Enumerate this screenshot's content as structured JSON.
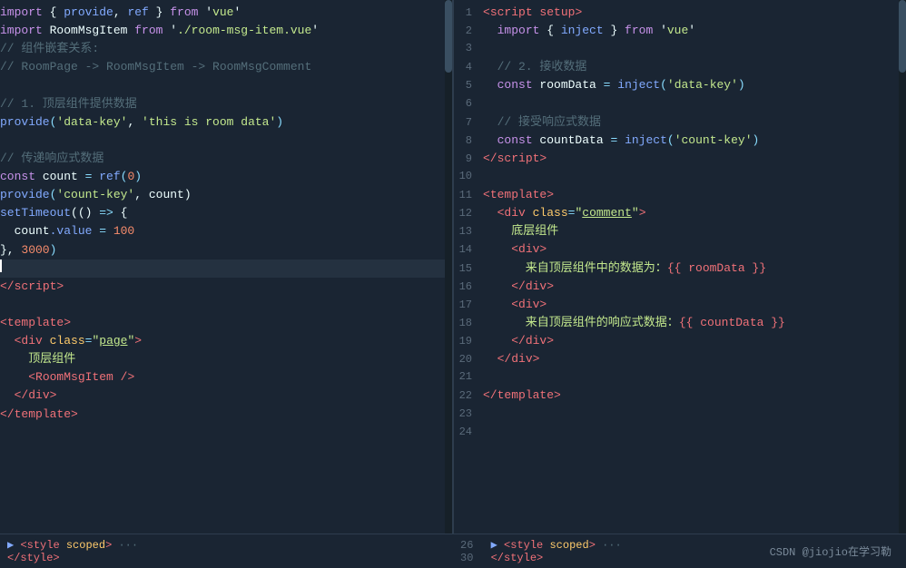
{
  "left_pane": {
    "lines": [
      {
        "num": null,
        "tokens": [
          {
            "text": "import",
            "cls": "kw"
          },
          {
            "text": " { ",
            "cls": "var"
          },
          {
            "text": "provide",
            "cls": "fn"
          },
          {
            "text": ", ",
            "cls": "var"
          },
          {
            "text": "ref",
            "cls": "fn"
          },
          {
            "text": " } ",
            "cls": "var"
          },
          {
            "text": "from",
            "cls": "kw"
          },
          {
            "text": " '",
            "cls": "var"
          },
          {
            "text": "vue",
            "cls": "str"
          },
          {
            "text": "'",
            "cls": "var"
          }
        ]
      },
      {
        "num": null,
        "tokens": [
          {
            "text": "import",
            "cls": "kw"
          },
          {
            "text": " RoomMsgItem ",
            "cls": "var"
          },
          {
            "text": "from",
            "cls": "kw"
          },
          {
            "text": " '",
            "cls": "var"
          },
          {
            "text": "./room-msg-item.vue",
            "cls": "str"
          },
          {
            "text": "'",
            "cls": "var"
          }
        ]
      },
      {
        "num": null,
        "tokens": [
          {
            "text": "// 组件嵌套关系:",
            "cls": "cmt"
          }
        ]
      },
      {
        "num": null,
        "tokens": [
          {
            "text": "// RoomPage -> RoomMsgItem -> RoomMsgComment",
            "cls": "cmt"
          }
        ]
      },
      {
        "num": null,
        "tokens": []
      },
      {
        "num": null,
        "tokens": [
          {
            "text": "// 1. 顶层组件提供数据",
            "cls": "cmt"
          }
        ]
      },
      {
        "num": null,
        "tokens": [
          {
            "text": "provide",
            "cls": "fn"
          },
          {
            "text": "(",
            "cls": "punc"
          },
          {
            "text": "'data-key'",
            "cls": "str"
          },
          {
            "text": ", ",
            "cls": "var"
          },
          {
            "text": "'this is room data'",
            "cls": "str"
          },
          {
            "text": ")",
            "cls": "punc"
          }
        ]
      },
      {
        "num": null,
        "tokens": []
      },
      {
        "num": null,
        "tokens": [
          {
            "text": "// 传递响应式数据",
            "cls": "cmt"
          }
        ]
      },
      {
        "num": null,
        "tokens": [
          {
            "text": "const",
            "cls": "kw"
          },
          {
            "text": " count ",
            "cls": "var"
          },
          {
            "text": "=",
            "cls": "op"
          },
          {
            "text": " ",
            "cls": "var"
          },
          {
            "text": "ref",
            "cls": "fn"
          },
          {
            "text": "(",
            "cls": "punc"
          },
          {
            "text": "0",
            "cls": "num"
          },
          {
            "text": ")",
            "cls": "punc"
          }
        ]
      },
      {
        "num": null,
        "tokens": [
          {
            "text": "provide",
            "cls": "fn"
          },
          {
            "text": "(",
            "cls": "punc"
          },
          {
            "text": "'count-key'",
            "cls": "str"
          },
          {
            "text": ", count)",
            "cls": "var"
          }
        ]
      },
      {
        "num": null,
        "tokens": [
          {
            "text": "setTimeout",
            "cls": "fn"
          },
          {
            "text": "(() ",
            "cls": "var"
          },
          {
            "text": "=>",
            "cls": "op"
          },
          {
            "text": " {",
            "cls": "var"
          }
        ]
      },
      {
        "num": null,
        "tokens": [
          {
            "text": "  count",
            "cls": "var"
          },
          {
            "text": ".value",
            "cls": "prop"
          },
          {
            "text": " = ",
            "cls": "op"
          },
          {
            "text": "100",
            "cls": "num"
          }
        ]
      },
      {
        "num": null,
        "tokens": [
          {
            "text": "}, ",
            "cls": "var"
          },
          {
            "text": "3000",
            "cls": "num"
          },
          {
            "text": ")",
            "cls": "punc"
          }
        ]
      },
      {
        "num": null,
        "tokens": [],
        "cursor": true
      },
      {
        "num": null,
        "tokens": [
          {
            "text": "</",
            "cls": "tag"
          },
          {
            "text": "script",
            "cls": "tag"
          },
          {
            "text": ">",
            "cls": "tag"
          }
        ]
      },
      {
        "num": null,
        "tokens": []
      },
      {
        "num": null,
        "tokens": [
          {
            "text": "<",
            "cls": "tag"
          },
          {
            "text": "template",
            "cls": "tag"
          },
          {
            "text": ">",
            "cls": "tag"
          }
        ]
      },
      {
        "num": null,
        "tokens": [
          {
            "text": "  <",
            "cls": "tag"
          },
          {
            "text": "div",
            "cls": "tag"
          },
          {
            "text": " ",
            "cls": "var"
          },
          {
            "text": "class",
            "cls": "attr"
          },
          {
            "text": "=",
            "cls": "op"
          },
          {
            "text": "\"",
            "cls": "str"
          },
          {
            "text": "page",
            "cls": "str underline"
          },
          {
            "text": "\"",
            "cls": "str"
          },
          {
            "text": ">",
            "cls": "tag"
          }
        ]
      },
      {
        "num": null,
        "tokens": [
          {
            "text": "    顶层组件",
            "cls": "chn"
          }
        ]
      },
      {
        "num": null,
        "tokens": [
          {
            "text": "    <",
            "cls": "tag"
          },
          {
            "text": "RoomMsgItem",
            "cls": "tag"
          },
          {
            "text": " />",
            "cls": "tag"
          }
        ]
      },
      {
        "num": null,
        "tokens": [
          {
            "text": "  </",
            "cls": "tag"
          },
          {
            "text": "div",
            "cls": "tag"
          },
          {
            "text": ">",
            "cls": "tag"
          }
        ]
      },
      {
        "num": null,
        "tokens": [
          {
            "text": "</",
            "cls": "tag"
          },
          {
            "text": "template",
            "cls": "tag"
          },
          {
            "text": ">",
            "cls": "tag"
          }
        ]
      }
    ],
    "bottom": {
      "collapsed": "▶  <style scoped> ···",
      "closing": "</style>"
    }
  },
  "right_pane": {
    "lines": [
      {
        "num": "1",
        "tokens": [
          {
            "text": "<",
            "cls": "tag"
          },
          {
            "text": "script setup",
            "cls": "tag"
          },
          {
            "text": ">",
            "cls": "tag"
          }
        ]
      },
      {
        "num": "2",
        "tokens": [
          {
            "text": "  ",
            "cls": "var"
          },
          {
            "text": "import",
            "cls": "kw"
          },
          {
            "text": " { ",
            "cls": "var"
          },
          {
            "text": "inject",
            "cls": "fn"
          },
          {
            "text": " } ",
            "cls": "var"
          },
          {
            "text": "from",
            "cls": "kw"
          },
          {
            "text": " '",
            "cls": "var"
          },
          {
            "text": "vue",
            "cls": "str"
          },
          {
            "text": "'",
            "cls": "var"
          }
        ]
      },
      {
        "num": "3",
        "tokens": []
      },
      {
        "num": "4",
        "tokens": [
          {
            "text": "  // 2. 接收数据",
            "cls": "cmt"
          }
        ]
      },
      {
        "num": "5",
        "tokens": [
          {
            "text": "  ",
            "cls": "var"
          },
          {
            "text": "const",
            "cls": "kw"
          },
          {
            "text": " roomData ",
            "cls": "var"
          },
          {
            "text": "=",
            "cls": "op"
          },
          {
            "text": " ",
            "cls": "var"
          },
          {
            "text": "inject",
            "cls": "fn"
          },
          {
            "text": "(",
            "cls": "punc"
          },
          {
            "text": "'data-key'",
            "cls": "str"
          },
          {
            "text": ")",
            "cls": "punc"
          }
        ]
      },
      {
        "num": "6",
        "tokens": []
      },
      {
        "num": "7",
        "tokens": [
          {
            "text": "  // 接受响应式数据",
            "cls": "cmt"
          }
        ]
      },
      {
        "num": "8",
        "tokens": [
          {
            "text": "  ",
            "cls": "var"
          },
          {
            "text": "const",
            "cls": "kw"
          },
          {
            "text": " countData ",
            "cls": "var"
          },
          {
            "text": "=",
            "cls": "op"
          },
          {
            "text": " ",
            "cls": "var"
          },
          {
            "text": "inject",
            "cls": "fn"
          },
          {
            "text": "(",
            "cls": "punc"
          },
          {
            "text": "'count-key'",
            "cls": "str"
          },
          {
            "text": ")",
            "cls": "punc"
          }
        ]
      },
      {
        "num": "9",
        "tokens": [
          {
            "text": "</",
            "cls": "tag"
          },
          {
            "text": "script",
            "cls": "tag"
          },
          {
            "text": ">",
            "cls": "tag"
          }
        ]
      },
      {
        "num": "10",
        "tokens": []
      },
      {
        "num": "11",
        "tokens": [
          {
            "text": "<",
            "cls": "tag"
          },
          {
            "text": "template",
            "cls": "tag"
          },
          {
            "text": ">",
            "cls": "tag"
          }
        ]
      },
      {
        "num": "12",
        "tokens": [
          {
            "text": "  <",
            "cls": "tag"
          },
          {
            "text": "div",
            "cls": "tag"
          },
          {
            "text": " ",
            "cls": "var"
          },
          {
            "text": "class",
            "cls": "attr"
          },
          {
            "text": "=",
            "cls": "op"
          },
          {
            "text": "\"",
            "cls": "str"
          },
          {
            "text": "comment",
            "cls": "str underline"
          },
          {
            "text": "\"",
            "cls": "str"
          },
          {
            "text": ">",
            "cls": "tag"
          }
        ]
      },
      {
        "num": "13",
        "tokens": [
          {
            "text": "    底层组件",
            "cls": "chn"
          }
        ]
      },
      {
        "num": "14",
        "tokens": [
          {
            "text": "    <",
            "cls": "tag"
          },
          {
            "text": "div",
            "cls": "tag"
          },
          {
            "text": ">",
            "cls": "tag"
          }
        ]
      },
      {
        "num": "15",
        "tokens": [
          {
            "text": "      来自顶层组件中的数据为：",
            "cls": "chn"
          },
          {
            "text": "{{ roomData }}",
            "cls": "template-expr"
          }
        ]
      },
      {
        "num": "16",
        "tokens": [
          {
            "text": "    </",
            "cls": "tag"
          },
          {
            "text": "div",
            "cls": "tag"
          },
          {
            "text": ">",
            "cls": "tag"
          }
        ]
      },
      {
        "num": "17",
        "tokens": [
          {
            "text": "    <",
            "cls": "tag"
          },
          {
            "text": "div",
            "cls": "tag"
          },
          {
            "text": ">",
            "cls": "tag"
          }
        ]
      },
      {
        "num": "18",
        "tokens": [
          {
            "text": "      来自顶层组件的响应式数据：",
            "cls": "chn"
          },
          {
            "text": "{{ countData }}",
            "cls": "template-expr"
          }
        ]
      },
      {
        "num": "19",
        "tokens": [
          {
            "text": "    </",
            "cls": "tag"
          },
          {
            "text": "div",
            "cls": "tag"
          },
          {
            "text": ">",
            "cls": "tag"
          }
        ]
      },
      {
        "num": "20",
        "tokens": [
          {
            "text": "  </",
            "cls": "tag"
          },
          {
            "text": "div",
            "cls": "tag"
          },
          {
            "text": ">",
            "cls": "tag"
          }
        ]
      },
      {
        "num": "21",
        "tokens": []
      },
      {
        "num": "22",
        "tokens": [
          {
            "text": "</",
            "cls": "tag"
          },
          {
            "text": "template",
            "cls": "tag"
          },
          {
            "text": ">",
            "cls": "tag"
          }
        ]
      },
      {
        "num": "23",
        "tokens": []
      },
      {
        "num": "24",
        "tokens": []
      }
    ],
    "bottom": {
      "collapsed": "▶  <style scoped> ···",
      "style_line": "26",
      "closing": "</style>",
      "closing_line": "30"
    },
    "watermark": "CSDN @jiojio在学习勒"
  }
}
